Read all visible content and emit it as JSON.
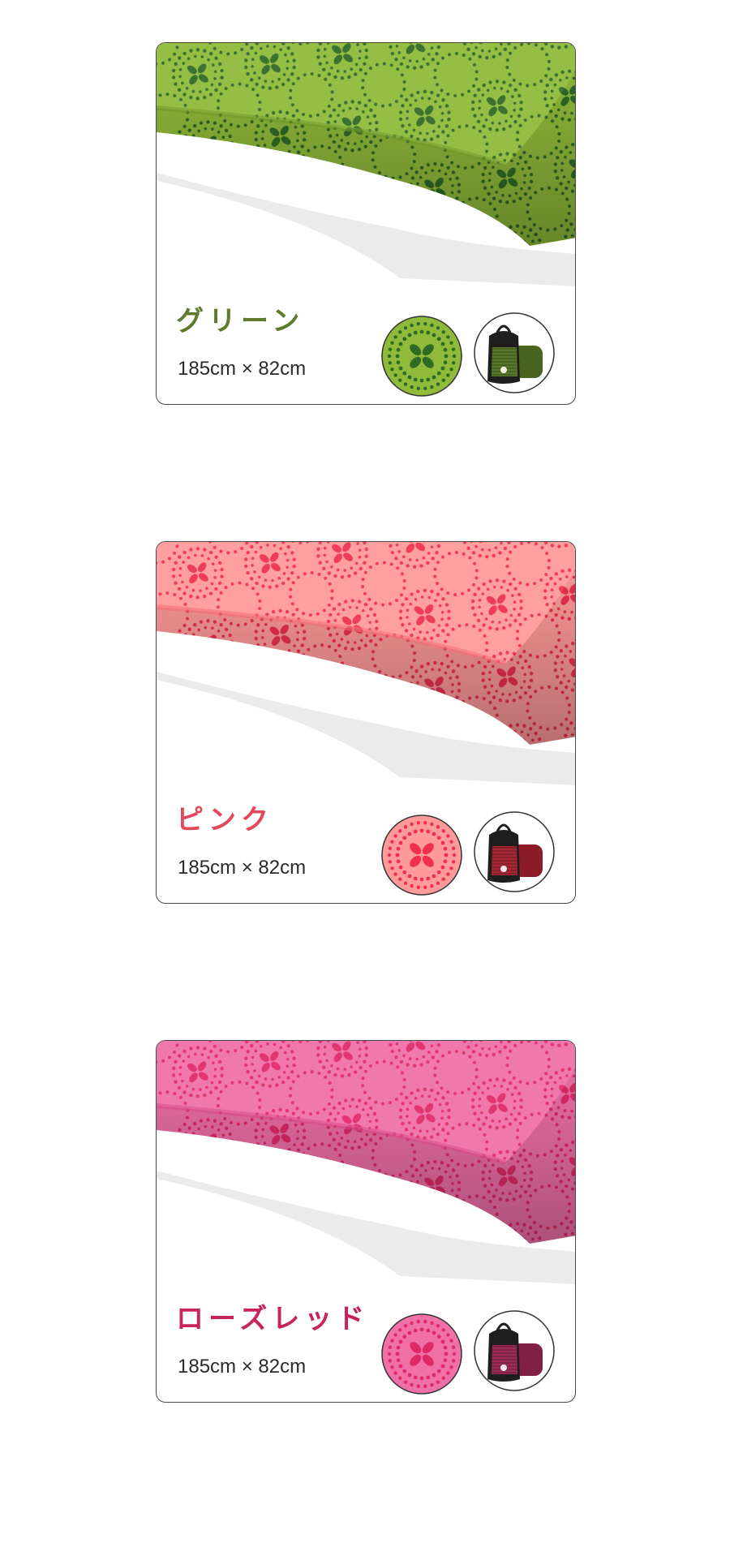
{
  "products": [
    {
      "name": "グリーン",
      "size": "185cm × 82cm",
      "name_color": "#5f7a2a",
      "towel_light": "#8fba3a",
      "towel_dark": "#2f6a26",
      "towel_shadow": "#6f9a2a",
      "bag_color": "#6f9a30"
    },
    {
      "name": "ピンク",
      "size": "185cm × 82cm",
      "name_color": "#e24a5c",
      "towel_light": "#ff9a9a",
      "towel_dark": "#ee2f52",
      "towel_shadow": "#f56a76",
      "bag_color": "#d82a3e"
    },
    {
      "name": "ローズレッド",
      "size": "185cm × 82cm",
      "name_color": "#c8245a",
      "towel_light": "#f070a8",
      "towel_dark": "#e02a68",
      "towel_shadow": "#d84a8a",
      "bag_color": "#c8306a"
    }
  ]
}
